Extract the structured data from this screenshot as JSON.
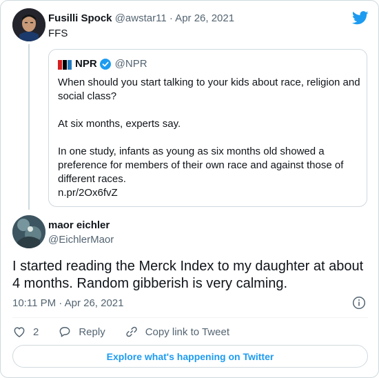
{
  "colors": {
    "accent": "#1d9bf0",
    "muted": "#536471",
    "border": "#cfd9de"
  },
  "parent_tweet": {
    "display_name": "Fusilli Spock",
    "handle_date": "@awstar11 · Apr 26, 2021",
    "text": "FFS"
  },
  "quoted_tweet": {
    "display_name": "NPR",
    "handle": "@NPR",
    "paragraphs": [
      "When should you start talking to your kids about race, religion and social class?",
      "At six months, experts say.",
      "In one study, infants as young as six months old showed a preference for members of their own race and against those of different races.",
      "n.pr/2Ox6fvZ"
    ]
  },
  "main_tweet": {
    "display_name": "maor eichler",
    "handle": "@EichlerMaor",
    "text": "I started reading the Merck Index to my daughter at about 4 months. Random gibberish is very calming.",
    "timestamp": "10:11 PM · Apr 26, 2021"
  },
  "actions": {
    "like_count": "2",
    "reply_label": "Reply",
    "copy_link_label": "Copy link to Tweet"
  },
  "explore_label": "Explore what's happening on Twitter",
  "icons": [
    "twitter-bird-icon",
    "verified-badge-icon",
    "info-icon",
    "heart-icon",
    "reply-bubble-icon",
    "link-icon"
  ]
}
